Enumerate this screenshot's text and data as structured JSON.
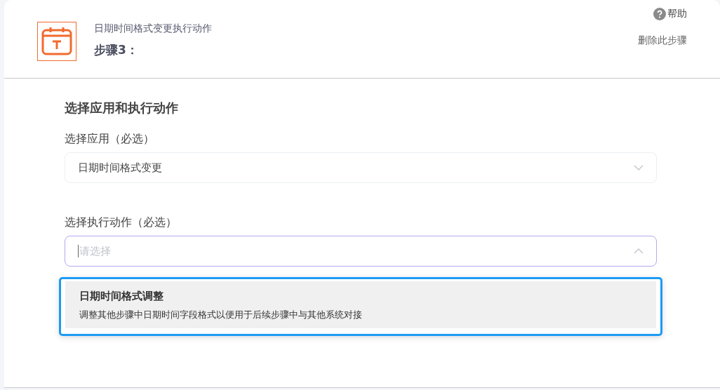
{
  "header": {
    "subtitle": "日期时间格式变更执行动作",
    "step": "步骤3：",
    "help": "帮助",
    "delete": "删除此步骤"
  },
  "section_title": "选择应用和执行动作",
  "fields": [
    {
      "label": "选择应用（必选）",
      "value": "日期时间格式变更",
      "expanded": false
    },
    {
      "label": "选择执行动作（必选）",
      "placeholder": "请选择",
      "expanded": true
    }
  ],
  "dropdown": {
    "options": [
      {
        "title": "日期时间格式调整",
        "description": "调整其他步骤中日期时间字段格式以便用于后续步骤中与其他系统对接",
        "selected": true
      }
    ]
  }
}
